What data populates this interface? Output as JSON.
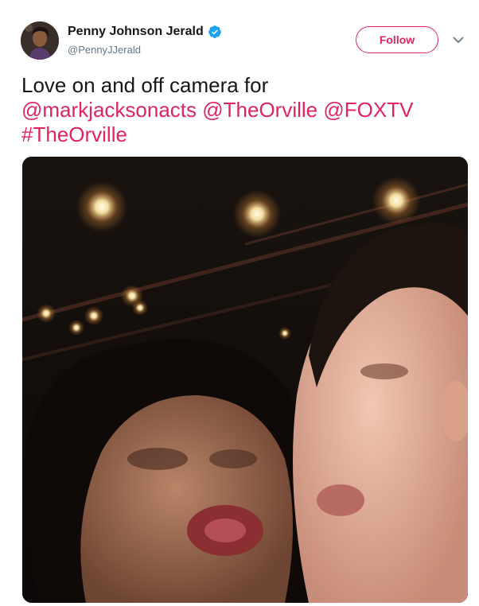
{
  "user": {
    "display_name": "Penny Johnson Jerald",
    "handle": "@PennyJJerald",
    "verified": true,
    "verified_icon": "verified-badge-icon",
    "avatar_icon": "profile-avatar"
  },
  "actions": {
    "follow_label": "Follow",
    "more_icon": "chevron-down-icon"
  },
  "tweet": {
    "text_plain": "Love on and off camera for",
    "mentions": [
      "@markjacksonacts",
      "@TheOrville",
      "@FOXTV"
    ],
    "hashtag": "#TheOrville"
  },
  "media": {
    "type": "photo",
    "description_icon": "selfie-photo"
  },
  "colors": {
    "accent": "#e0245e",
    "verified_blue": "#1da1f2",
    "text_primary": "#14171a",
    "text_secondary": "#657786"
  }
}
